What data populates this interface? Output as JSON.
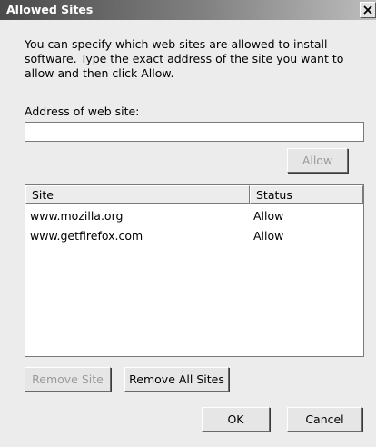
{
  "window": {
    "title": "Allowed Sites",
    "close_icon": "close-icon"
  },
  "description": "You can specify which web sites are allowed to install software. Type the exact address of the site you want to allow and then click Allow.",
  "address": {
    "label": "Address of web site:",
    "value": ""
  },
  "allow_button": {
    "label": "Allow",
    "enabled": false
  },
  "list": {
    "columns": [
      "Site",
      "Status"
    ],
    "rows": [
      {
        "site": "www.mozilla.org",
        "status": "Allow"
      },
      {
        "site": "www.getfirefox.com",
        "status": "Allow"
      }
    ]
  },
  "buttons": {
    "remove_site": {
      "label": "Remove Site",
      "enabled": false
    },
    "remove_all_sites": {
      "label": "Remove All Sites",
      "enabled": true
    },
    "ok": {
      "label": "OK"
    },
    "cancel": {
      "label": "Cancel"
    }
  },
  "colors": {
    "titlebar_dark": "#4a4a4a",
    "titlebar_light": "#bdbdbd",
    "dialog_bg": "#ececec",
    "disabled_text": "#9a9a9a"
  }
}
